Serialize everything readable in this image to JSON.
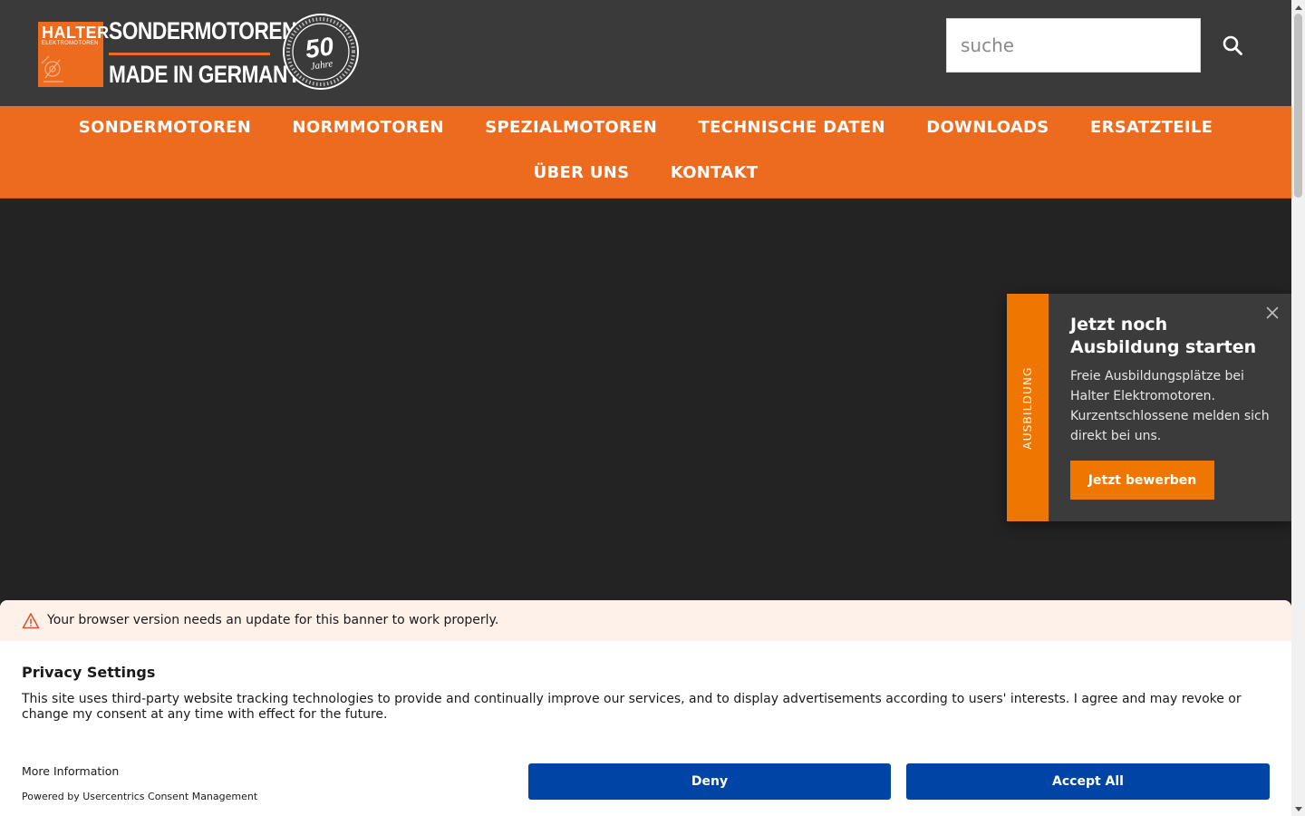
{
  "header": {
    "logo": {
      "brand": "HALTER",
      "brand_sub": "ELEKTROMOTOREN",
      "line1": "SONDERMOTOREN",
      "line2": "MADE IN GERMANY",
      "seal_number": "50",
      "seal_word": "Jahre"
    },
    "search": {
      "placeholder": "suche"
    }
  },
  "nav": {
    "row1": [
      "SONDERMOTOREN",
      "NORMMOTOREN",
      "SPEZIALMOTOREN",
      "TECHNISCHE DATEN",
      "DOWNLOADS",
      "ERSATZTEILE"
    ],
    "row2": [
      "ÜBER UNS",
      "KONTAKT"
    ]
  },
  "popup": {
    "tab_label": "AUSBILDUNG",
    "title": "Jetzt noch Ausbildung starten",
    "text": "Freie Ausbildungsplätze bei Halter Elektromotoren. Kurzentschlossene melden sich direkt bei uns.",
    "button": "Jetzt bewerben"
  },
  "consent": {
    "warning": "Your browser version needs an update for this banner to work properly.",
    "title": "Privacy Settings",
    "text": "This site uses third-party website tracking technologies to provide and continually improve our services, and to display advertisements according to users' interests. I agree and may revoke or change my consent at any time with effect for the future.",
    "more_info": "More Information",
    "powered_by": "Powered by Usercentrics Consent Management",
    "deny": "Deny",
    "accept": "Accept All"
  },
  "colors": {
    "header_bg": "#3a3a3a",
    "nav_orange": "#ec6b1e",
    "popup_orange": "#ef7600",
    "consent_button": "#0045a5",
    "warning_bg": "#fdf1ea"
  },
  "icons": {
    "search": "search-icon",
    "close": "close-icon",
    "warning": "warning-triangle-icon"
  }
}
